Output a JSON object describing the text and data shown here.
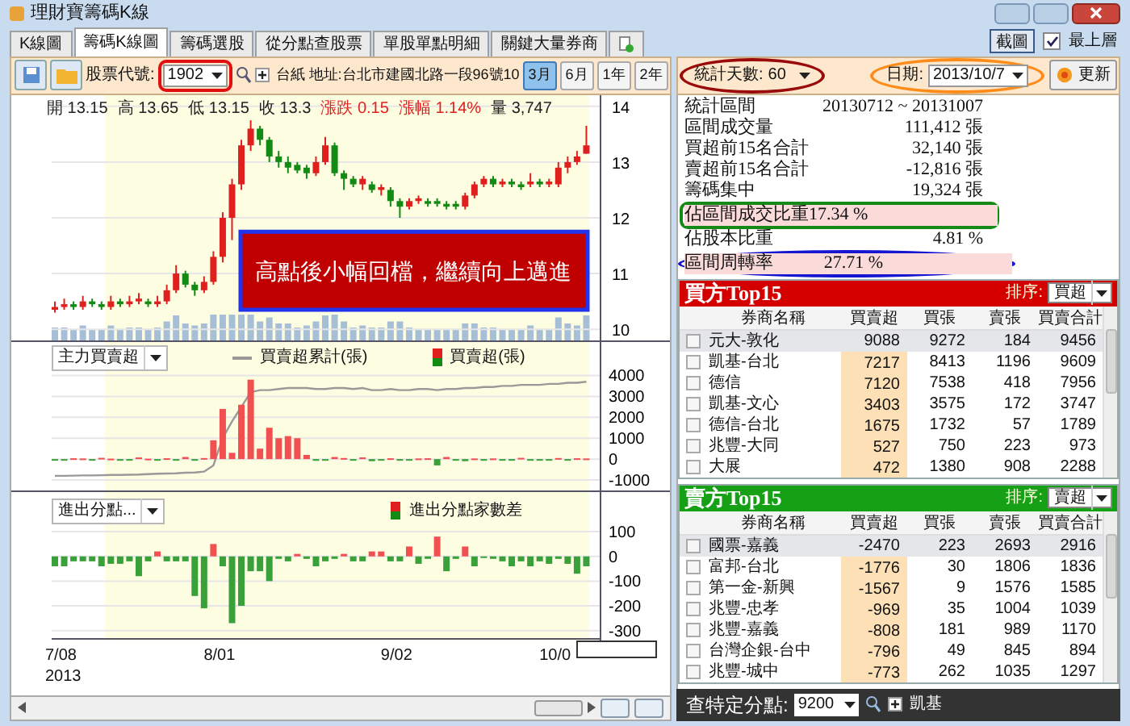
{
  "window": {
    "title": "理財寶籌碼K線"
  },
  "tabs": [
    {
      "label": "K線圖",
      "selected": false
    },
    {
      "label": "籌碼K線圖",
      "selected": true
    },
    {
      "label": "籌碼選股",
      "selected": false
    },
    {
      "label": "從分點查股票",
      "selected": false
    },
    {
      "label": "單股單點明細",
      "selected": false
    },
    {
      "label": "關鍵大量券商",
      "selected": false
    }
  ],
  "screenshot_button": "截圖",
  "always_on_top": {
    "label": "最上層",
    "checked": true
  },
  "toolbar": {
    "stock_code_label": "股票代號:",
    "stock_code": "1902",
    "stock_info": "台紙  地址:台北市建國北路一段96號10",
    "ranges": [
      {
        "label": "3月",
        "selected": true
      },
      {
        "label": "6月",
        "selected": false
      },
      {
        "label": "1年",
        "selected": false
      },
      {
        "label": "2年",
        "selected": false
      }
    ]
  },
  "chart": {
    "quote": [
      {
        "label": "開",
        "value": "13.15",
        "kind": "plain"
      },
      {
        "label": "高",
        "value": "13.65",
        "kind": "plain"
      },
      {
        "label": "低",
        "value": "13.15",
        "kind": "plain"
      },
      {
        "label": "收",
        "value": "13.3",
        "kind": "plain"
      },
      {
        "label": "漲跌",
        "value": "0.15",
        "kind": "change"
      },
      {
        "label": "漲幅",
        "value": "1.14%",
        "kind": "change"
      },
      {
        "label": "量",
        "value": "3,747",
        "kind": "plain"
      }
    ],
    "annotation": "高點後小幅回檔，繼續向上邁進",
    "chart_data": {
      "type": "candlestick",
      "ylim": [
        9.8,
        14.2
      ],
      "yticks": [
        14,
        13,
        12,
        11,
        10
      ],
      "grid": true,
      "ohlc": [
        [
          10.35,
          10.5,
          10.3,
          10.4
        ],
        [
          10.4,
          10.55,
          10.35,
          10.45
        ],
        [
          10.45,
          10.5,
          10.35,
          10.4
        ],
        [
          10.4,
          10.6,
          10.35,
          10.5
        ],
        [
          10.5,
          10.55,
          10.4,
          10.45
        ],
        [
          10.45,
          10.5,
          10.35,
          10.4
        ],
        [
          10.4,
          10.6,
          10.35,
          10.5
        ],
        [
          10.5,
          10.55,
          10.4,
          10.45
        ],
        [
          10.45,
          10.6,
          10.4,
          10.5
        ],
        [
          10.5,
          10.65,
          10.45,
          10.55
        ],
        [
          10.5,
          10.55,
          10.4,
          10.45
        ],
        [
          10.45,
          10.6,
          10.4,
          10.5
        ],
        [
          10.5,
          10.8,
          10.45,
          10.7
        ],
        [
          10.7,
          11.15,
          10.65,
          11.0
        ],
        [
          11.0,
          11.05,
          10.75,
          10.8
        ],
        [
          10.8,
          10.85,
          10.6,
          10.7
        ],
        [
          10.7,
          10.95,
          10.65,
          10.85
        ],
        [
          10.85,
          11.4,
          10.8,
          11.3
        ],
        [
          11.3,
          12.1,
          11.2,
          12.0
        ],
        [
          12.0,
          12.7,
          11.6,
          12.6
        ],
        [
          12.6,
          13.4,
          12.5,
          13.3
        ],
        [
          13.3,
          13.75,
          13.2,
          13.6
        ],
        [
          13.6,
          13.65,
          13.3,
          13.4
        ],
        [
          13.4,
          13.45,
          13.0,
          13.1
        ],
        [
          13.1,
          13.2,
          12.9,
          13.0
        ],
        [
          13.0,
          13.1,
          12.8,
          12.9
        ],
        [
          12.95,
          13.0,
          12.8,
          12.85
        ],
        [
          12.9,
          12.95,
          12.7,
          12.8
        ],
        [
          12.8,
          13.1,
          12.75,
          13.0
        ],
        [
          13.0,
          13.45,
          12.95,
          13.3
        ],
        [
          13.3,
          13.35,
          12.75,
          12.8
        ],
        [
          12.8,
          12.85,
          12.5,
          12.7
        ],
        [
          12.7,
          12.75,
          12.55,
          12.6
        ],
        [
          12.6,
          12.75,
          12.5,
          12.7
        ],
        [
          12.6,
          12.65,
          12.45,
          12.5
        ],
        [
          12.5,
          12.6,
          12.4,
          12.55
        ],
        [
          12.5,
          12.55,
          12.2,
          12.3
        ],
        [
          12.3,
          12.35,
          12.0,
          12.2
        ],
        [
          12.2,
          12.35,
          12.15,
          12.3
        ],
        [
          12.3,
          12.4,
          12.25,
          12.35
        ],
        [
          12.3,
          12.35,
          12.2,
          12.25
        ],
        [
          12.3,
          12.35,
          12.2,
          12.25
        ],
        [
          12.25,
          12.3,
          12.15,
          12.2
        ],
        [
          12.25,
          12.3,
          12.15,
          12.2
        ],
        [
          12.2,
          12.45,
          12.15,
          12.4
        ],
        [
          12.4,
          12.65,
          12.35,
          12.6
        ],
        [
          12.6,
          12.75,
          12.55,
          12.7
        ],
        [
          12.7,
          12.75,
          12.55,
          12.6
        ],
        [
          12.6,
          12.7,
          12.55,
          12.65
        ],
        [
          12.65,
          12.7,
          12.55,
          12.6
        ],
        [
          12.6,
          12.65,
          12.5,
          12.55
        ],
        [
          12.6,
          12.8,
          12.55,
          12.65
        ],
        [
          12.65,
          12.7,
          12.55,
          12.6
        ],
        [
          12.6,
          12.7,
          12.55,
          12.65
        ],
        [
          12.6,
          13.0,
          12.55,
          12.9
        ],
        [
          12.9,
          13.1,
          12.8,
          13.0
        ],
        [
          13.0,
          13.2,
          12.95,
          13.1
        ],
        [
          13.15,
          13.65,
          13.15,
          13.3
        ]
      ]
    },
    "flow_panel": {
      "selector": "主力買賣超",
      "chart_data": {
        "type": "bar",
        "ylim": [
          -1500,
          5600
        ],
        "yticks": [
          4000,
          3000,
          2000,
          1000,
          0,
          -1000
        ],
        "grid": true,
        "series": [
          {
            "name": "買賣超累計(張)",
            "type": "line",
            "color": "#999999",
            "values": [
              -800,
              -800,
              -790,
              -780,
              -780,
              -770,
              -760,
              -760,
              -750,
              -740,
              -720,
              -700,
              -690,
              -680,
              -650,
              -640,
              -600,
              -300,
              1000,
              1800,
              2500,
              3200,
              3300,
              3300,
              3350,
              3400,
              3400,
              3400,
              3350,
              3350,
              3400,
              3400,
              3350,
              3400,
              3300,
              3300,
              3350,
              3300,
              3300,
              3350,
              3350,
              3300,
              3350,
              3350,
              3400,
              3400,
              3450,
              3450,
              3500,
              3500,
              3550,
              3550,
              3550,
              3600,
              3600,
              3650,
              3650,
              3700
            ]
          },
          {
            "name": "買賣超(張)",
            "type": "bar",
            "values": [
              -50,
              -60,
              40,
              30,
              -40,
              60,
              20,
              -30,
              -20,
              80,
              20,
              -10,
              40,
              -20,
              100,
              -30,
              50,
              900,
              2400,
              300,
              2600,
              3800,
              500,
              1500,
              1000,
              1100,
              1000,
              200,
              -80,
              -20,
              100,
              50,
              -60,
              80,
              -100,
              -50,
              40,
              -60,
              -30,
              30,
              40,
              -300,
              100,
              -60,
              -100,
              30,
              -60,
              30,
              -40,
              -30,
              60,
              -30,
              -40,
              -30,
              50,
              -30,
              40,
              30
            ],
            "colors": [
              "#3aa13a",
              "#3aa13a",
              "#f25050",
              "#f25050",
              "#3aa13a",
              "#f25050",
              "#f25050",
              "#3aa13a",
              "#3aa13a",
              "#f25050",
              "#f25050",
              "#3aa13a",
              "#f25050",
              "#3aa13a",
              "#f25050",
              "#3aa13a",
              "#f25050",
              "#f25050",
              "#f25050",
              "#f25050",
              "#f25050",
              "#f25050",
              "#f25050",
              "#f25050",
              "#f25050",
              "#f25050",
              "#f25050",
              "#f25050",
              "#3aa13a",
              "#3aa13a",
              "#f25050",
              "#f25050",
              "#3aa13a",
              "#f25050",
              "#3aa13a",
              "#3aa13a",
              "#f25050",
              "#3aa13a",
              "#3aa13a",
              "#f25050",
              "#f25050",
              "#3aa13a",
              "#f25050",
              "#3aa13a",
              "#3aa13a",
              "#f25050",
              "#3aa13a",
              "#f25050",
              "#3aa13a",
              "#3aa13a",
              "#f25050",
              "#3aa13a",
              "#3aa13a",
              "#3aa13a",
              "#f25050",
              "#3aa13a",
              "#f25050",
              "#f25050"
            ]
          }
        ]
      }
    },
    "branch_panel": {
      "selector": "進出分點...",
      "chart_data": {
        "type": "bar",
        "ylim": [
          -340,
          260
        ],
        "yticks": [
          100,
          0,
          -100,
          -200,
          -300
        ],
        "grid": true,
        "series": [
          {
            "name": "進出分點家數差",
            "type": "bar",
            "values": [
              -40,
              -40,
              -20,
              -20,
              -20,
              -40,
              -30,
              -30,
              -20,
              -80,
              -20,
              20,
              -20,
              -20,
              -20,
              -160,
              -210,
              50,
              -40,
              -270,
              -200,
              -60,
              -60,
              -100,
              -10,
              -20,
              10,
              -10,
              -40,
              -20,
              -10,
              10,
              -20,
              -20,
              20,
              20,
              -20,
              -20,
              40,
              -30,
              -10,
              80,
              -60,
              -10,
              40,
              -40,
              -5,
              -10,
              -20,
              -40,
              -20,
              -40,
              -20,
              -30,
              -10,
              -30,
              -70,
              -40
            ],
            "colors": [
              "#3aa13a",
              "#3aa13a",
              "#3aa13a",
              "#3aa13a",
              "#3aa13a",
              "#3aa13a",
              "#3aa13a",
              "#3aa13a",
              "#3aa13a",
              "#3aa13a",
              "#3aa13a",
              "#f25050",
              "#3aa13a",
              "#3aa13a",
              "#3aa13a",
              "#3aa13a",
              "#3aa13a",
              "#f25050",
              "#3aa13a",
              "#3aa13a",
              "#3aa13a",
              "#3aa13a",
              "#3aa13a",
              "#3aa13a",
              "#3aa13a",
              "#3aa13a",
              "#f25050",
              "#3aa13a",
              "#3aa13a",
              "#3aa13a",
              "#3aa13a",
              "#f25050",
              "#3aa13a",
              "#3aa13a",
              "#f25050",
              "#f25050",
              "#3aa13a",
              "#3aa13a",
              "#f25050",
              "#3aa13a",
              "#3aa13a",
              "#f25050",
              "#3aa13a",
              "#3aa13a",
              "#f25050",
              "#3aa13a",
              "#3aa13a",
              "#3aa13a",
              "#3aa13a",
              "#3aa13a",
              "#3aa13a",
              "#3aa13a",
              "#3aa13a",
              "#3aa13a",
              "#3aa13a",
              "#3aa13a",
              "#3aa13a",
              "#3aa13a"
            ]
          }
        ]
      }
    },
    "x_labels": [
      "7/08",
      "8/01",
      "9/02",
      "10/0"
    ],
    "year_label": "2013"
  },
  "stats_panel": {
    "days_label": "統計天數:",
    "days": "60",
    "date_label": "日期:",
    "date": "2013/10/7",
    "refresh_button": "更新",
    "rows": [
      {
        "label": "統計區間",
        "value": "20130712 ~ 20131007",
        "highlighted": false,
        "boxed": false,
        "circled": false
      },
      {
        "label": "區間成交量",
        "value": "111,412 張",
        "highlighted": false,
        "boxed": false,
        "circled": false
      },
      {
        "label": "買超前15名合計",
        "value": "32,140 張",
        "highlighted": false,
        "boxed": false,
        "circled": false
      },
      {
        "label": "賣超前15名合計",
        "value": "-12,816 張",
        "highlighted": false,
        "boxed": false,
        "circled": false
      },
      {
        "label": "籌碼集中",
        "value": "19,324 張",
        "highlighted": false,
        "boxed": false,
        "circled": false
      },
      {
        "label": "佔區間成交比重",
        "value": "17.34 %",
        "highlighted": true,
        "boxed": true,
        "circled": false
      },
      {
        "label": "佔股本比重",
        "value": "4.81 %",
        "highlighted": false,
        "boxed": false,
        "circled": false
      },
      {
        "label": "區間周轉率",
        "value": "27.71 %",
        "highlighted": true,
        "boxed": false,
        "circled": true
      }
    ]
  },
  "buy_table": {
    "title": "買方Top15",
    "sort_label": "排序:",
    "sort": "買超",
    "columns": [
      "券商名稱",
      "買賣超",
      "買張",
      "賣張",
      "買賣合計"
    ],
    "rows": [
      {
        "cells": [
          "元大-敦化",
          "9088",
          "9272",
          "184",
          "9456"
        ],
        "checked": false,
        "selected": true
      },
      {
        "cells": [
          "凱基-台北",
          "7217",
          "8413",
          "1196",
          "9609"
        ],
        "checked": false,
        "selected": false
      },
      {
        "cells": [
          "德信",
          "7120",
          "7538",
          "418",
          "7956"
        ],
        "checked": false,
        "selected": false
      },
      {
        "cells": [
          "凱基-文心",
          "3403",
          "3575",
          "172",
          "3747"
        ],
        "checked": false,
        "selected": false
      },
      {
        "cells": [
          "德信-台北",
          "1675",
          "1732",
          "57",
          "1789"
        ],
        "checked": false,
        "selected": false
      },
      {
        "cells": [
          "兆豐-大同",
          "527",
          "750",
          "223",
          "973"
        ],
        "checked": false,
        "selected": false
      },
      {
        "cells": [
          "大展",
          "472",
          "1380",
          "908",
          "2288"
        ],
        "checked": false,
        "selected": false
      }
    ]
  },
  "sell_table": {
    "title": "賣方Top15",
    "sort_label": "排序:",
    "sort": "賣超",
    "columns": [
      "券商名稱",
      "買賣超",
      "買張",
      "賣張",
      "買賣合計"
    ],
    "rows": [
      {
        "cells": [
          "國票-嘉義",
          "-2470",
          "223",
          "2693",
          "2916"
        ],
        "checked": false,
        "selected": true
      },
      {
        "cells": [
          "富邦-台北",
          "-1776",
          "30",
          "1806",
          "1836"
        ],
        "checked": false,
        "selected": false
      },
      {
        "cells": [
          "第一金-新興",
          "-1567",
          "9",
          "1576",
          "1585"
        ],
        "checked": false,
        "selected": false
      },
      {
        "cells": [
          "兆豐-忠孝",
          "-969",
          "35",
          "1004",
          "1039"
        ],
        "checked": false,
        "selected": false
      },
      {
        "cells": [
          "兆豐-嘉義",
          "-808",
          "181",
          "989",
          "1170"
        ],
        "checked": false,
        "selected": false
      },
      {
        "cells": [
          "台灣企銀-台中",
          "-796",
          "49",
          "845",
          "894"
        ],
        "checked": false,
        "selected": false
      },
      {
        "cells": [
          "兆豐-城中",
          "-773",
          "262",
          "1035",
          "1297"
        ],
        "checked": false,
        "selected": false
      }
    ]
  },
  "branch_lookup": {
    "label": "查特定分點:",
    "code": "9200",
    "name": "凱基"
  }
}
